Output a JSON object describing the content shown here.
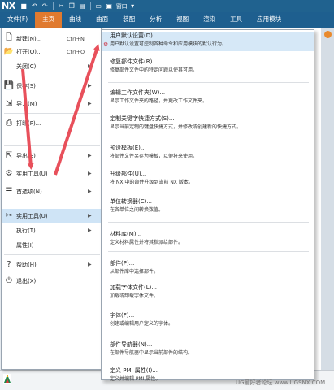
{
  "app": {
    "logo": "NX"
  },
  "quickbar": {
    "window_text": "窗口"
  },
  "tabs": [
    {
      "label": "文件(F)"
    },
    {
      "label": "主页",
      "active": true
    },
    {
      "label": "曲线"
    },
    {
      "label": "曲面"
    },
    {
      "label": "装配"
    },
    {
      "label": "分析"
    },
    {
      "label": "视图"
    },
    {
      "label": "渲染"
    },
    {
      "label": "工具"
    },
    {
      "label": "应用模块"
    }
  ],
  "file_menu": {
    "items": [
      {
        "label": "新建(N)...",
        "shortcut": "Ctrl+N",
        "icon": "new-file-icon"
      },
      {
        "label": "打开(O)...",
        "shortcut": "Ctrl+O",
        "icon": "open-folder-icon"
      },
      {
        "label": "关闭(C)",
        "arrow": true,
        "icon": "none"
      },
      {
        "label": "保存(S)",
        "arrow": true,
        "icon": "save-icon"
      },
      {
        "label": "导入(M)",
        "arrow": true,
        "icon": "import-icon"
      },
      {
        "label": "打印(P)...",
        "icon": "print-icon"
      },
      {
        "label": "导出(E)",
        "arrow": true,
        "icon": "export-icon"
      },
      {
        "label": "实用工具(U)",
        "arrow": true,
        "icon": "utilities-icon"
      },
      {
        "label": "首选项(N)",
        "arrow": true,
        "icon": "preferences-icon"
      },
      {
        "label": "实用工具(U)",
        "arrow": true,
        "icon": "tools-icon",
        "selected": true
      },
      {
        "label": "执行(T)",
        "arrow": true,
        "icon": "none"
      },
      {
        "label": "属性(I)",
        "icon": "none"
      },
      {
        "label": "帮助(H)",
        "arrow": true,
        "icon": "help-icon"
      },
      {
        "label": "退出(X)",
        "icon": "exit-icon"
      }
    ]
  },
  "submenu": {
    "items": [
      {
        "title": "用户默认设置(D)...",
        "desc": "用户默认设置可控制各种命令和应用模块的默认行为。"
      },
      {
        "title": "修复部件文件(R)...",
        "desc": "修复部件文件中的特定问题以使其可用。"
      },
      {
        "title": "编辑工作文件夹(W)...",
        "desc": "显示工作文件夹的路径，并更改工作文件夹。"
      },
      {
        "title": "定制关键字快捷方式(S)...",
        "desc": "显示当前定制的键盘快捷方式，并修改或创建新的快捷方式。"
      },
      {
        "title": "预设模板(E)...",
        "desc": "将部件文件另存为模板，以便将来使用。"
      },
      {
        "title": "升级部件(U)...",
        "desc": "将 NX 中的部件升级到当前 NX 版本。"
      },
      {
        "title": "单位转换器(C)...",
        "desc": "在各单位之间转换数值。"
      },
      {
        "title": "材料库(M)...",
        "desc": "定义材料属性并将其指派给部件。"
      },
      {
        "title": "部件(P)...",
        "desc": "从部件库中选择部件。"
      },
      {
        "title": "加载字体文件(L)...",
        "desc": "加载或卸载字体文件。"
      },
      {
        "title": "字体(F)...",
        "desc": "创建或编辑用户定义的字体。"
      },
      {
        "title": "部件导航器(N)...",
        "desc": "在部件导航器中显示当前部件的结构。"
      },
      {
        "title": "定义 PMI 属性(I)...",
        "desc": "定义并编辑 PMI 属性。"
      }
    ]
  },
  "watermark": "UG爱好者论坛 www.UGSNX.COM",
  "colors": {
    "ribbon": "#1e5f8f",
    "active_tab": "#e07a2f",
    "arrow": "#e8505b",
    "selection": "#cfe4f6"
  }
}
